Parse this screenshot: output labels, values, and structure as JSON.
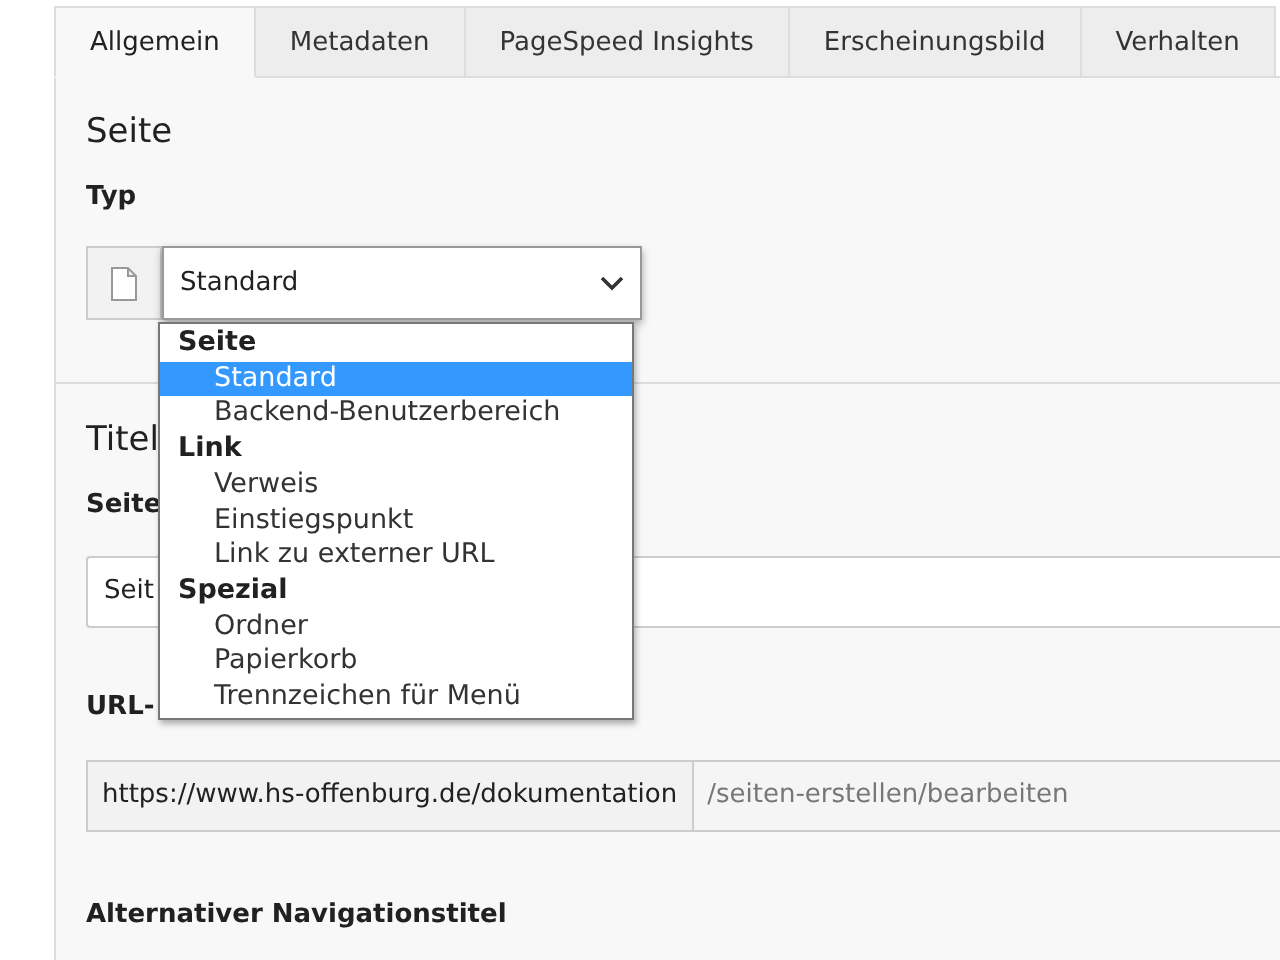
{
  "tabs": [
    {
      "label": "Allgemein",
      "selected": true
    },
    {
      "label": "Metadaten",
      "selected": false
    },
    {
      "label": "PageSpeed Insights",
      "selected": false
    },
    {
      "label": "Erscheinungsbild",
      "selected": false
    },
    {
      "label": "Verhalten",
      "selected": false
    }
  ],
  "page_section": {
    "heading": "Seite",
    "type_label": "Typ",
    "type_select": {
      "value": "Standard",
      "expanded": true
    }
  },
  "dropdown": {
    "groups": [
      {
        "label": "Seite",
        "options": [
          {
            "label": "Standard",
            "selected": true
          },
          {
            "label": "Backend-Benutzerbereich",
            "selected": false
          }
        ]
      },
      {
        "label": "Link",
        "options": [
          {
            "label": "Verweis",
            "selected": false
          },
          {
            "label": "Einstiegspunkt",
            "selected": false
          },
          {
            "label": "Link zu externer URL",
            "selected": false
          }
        ]
      },
      {
        "label": "Spezial",
        "options": [
          {
            "label": "Ordner",
            "selected": false
          },
          {
            "label": "Papierkorb",
            "selected": false
          },
          {
            "label": "Trennzeichen für Menü",
            "selected": false
          }
        ]
      }
    ]
  },
  "title_section": {
    "heading": "Titel",
    "page_title_label": "Seite",
    "page_title_value": "Seit",
    "url_label": "URL-",
    "url_prefix": "https://www.hs-offenburg.de/dokumentation",
    "url_segment": "/seiten-erstellen/bearbeiten",
    "nav_title_label": "Alternativer Navigationstitel"
  }
}
